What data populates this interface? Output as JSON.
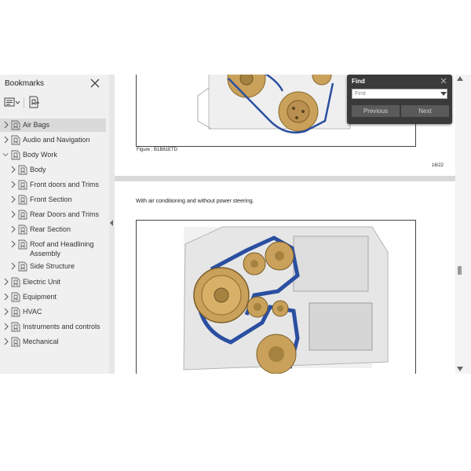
{
  "colors": {
    "sidebar_bg": "#f0f0f0",
    "selected_bg": "#dadada",
    "find_bg": "#3a3a3a",
    "belt_blue": "#2b4fa0",
    "pulley_gold": "#c9a15a"
  },
  "sidebar": {
    "title": "Bookmarks",
    "close_icon": "close-icon",
    "toolbar": {
      "options_icon": "bookmark-options-icon",
      "new_bookmark_icon": "new-bookmark-icon"
    },
    "items": [
      {
        "label": "Air Bags",
        "expanded": false,
        "selected": true
      },
      {
        "label": "Audio and Navigation",
        "expanded": false
      },
      {
        "label": "Body Work",
        "expanded": true,
        "children": [
          {
            "label": "Body",
            "expanded": false
          },
          {
            "label": "Front doors and Trims",
            "expanded": false
          },
          {
            "label": "Front Section",
            "expanded": false
          },
          {
            "label": "Rear Doors and Trims",
            "expanded": false
          },
          {
            "label": "Rear Section",
            "expanded": false
          },
          {
            "label": "Roof and Headlining Assembly",
            "expanded": false
          },
          {
            "label": "Side Structure",
            "expanded": false
          }
        ]
      },
      {
        "label": "Electric Unit",
        "expanded": false
      },
      {
        "label": "Equipment",
        "expanded": false
      },
      {
        "label": "HVAC",
        "expanded": false
      },
      {
        "label": "Instruments and controls",
        "expanded": false
      },
      {
        "label": "Mechanical",
        "expanded": false
      }
    ]
  },
  "document": {
    "figure_caption": "Figure : B1B81ETD",
    "page_number": "16/22",
    "section_text": "With air conditioning and without power steering."
  },
  "find_panel": {
    "title": "Find",
    "input_placeholder": "Find",
    "previous_label": "Previous",
    "next_label": "Next"
  }
}
